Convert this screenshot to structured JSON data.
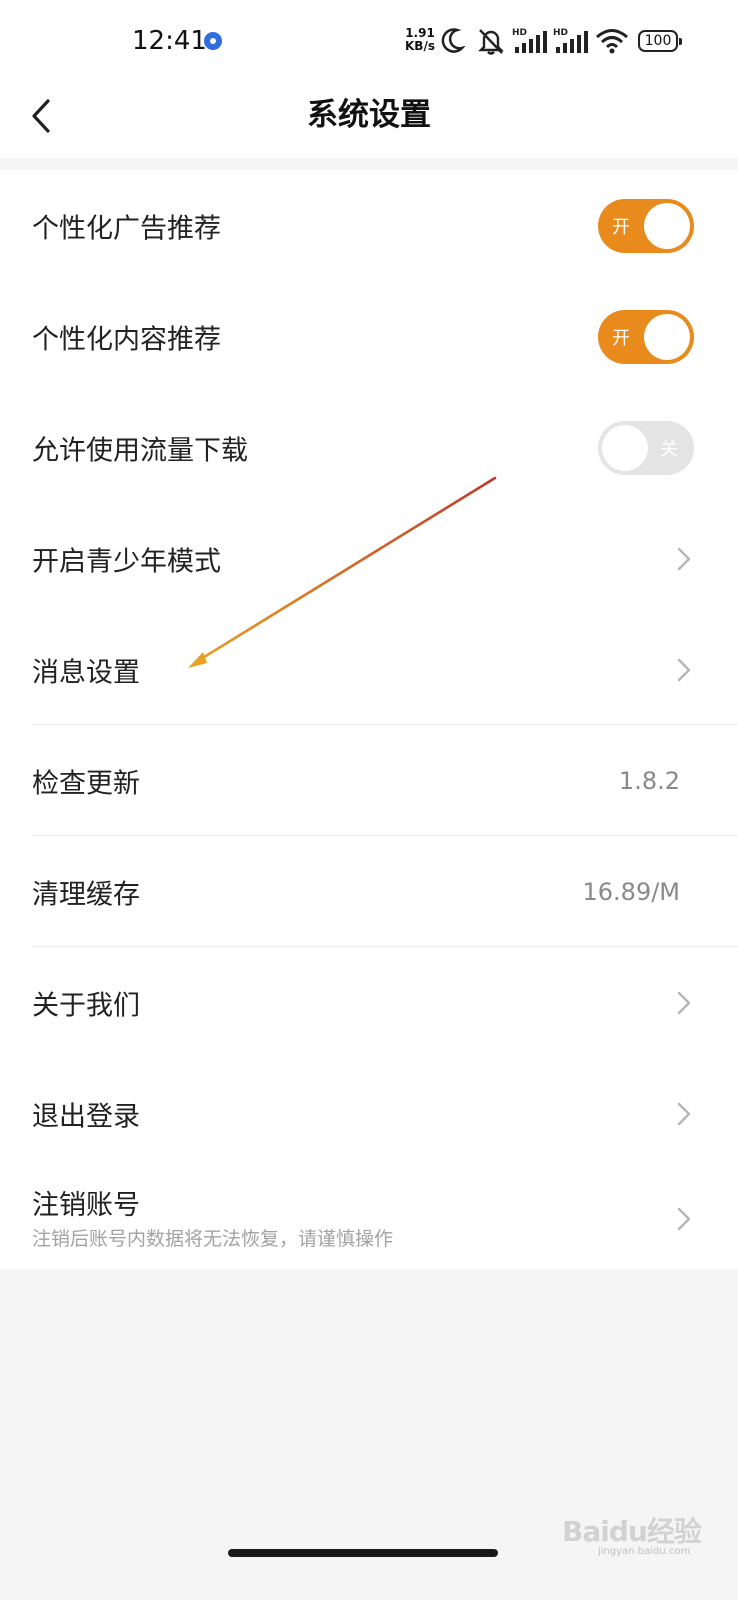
{
  "status_bar": {
    "time": "12:41",
    "net_speed_value": "1.91",
    "net_speed_unit": "KB/s",
    "signal1_label": "HD",
    "signal2_label": "HD",
    "battery": "100"
  },
  "header": {
    "title": "系统设置"
  },
  "settings": {
    "personalized_ads": {
      "label": "个性化广告推荐",
      "toggle_text": "开",
      "state": "on"
    },
    "personalized_content": {
      "label": "个性化内容推荐",
      "toggle_text": "开",
      "state": "on"
    },
    "mobile_data_download": {
      "label": "允许使用流量下载",
      "toggle_text": "关",
      "state": "off"
    },
    "teen_mode": {
      "label": "开启青少年模式"
    },
    "message_settings": {
      "label": "消息设置"
    },
    "check_update": {
      "label": "检查更新",
      "value": "1.8.2"
    },
    "clear_cache": {
      "label": "清理缓存",
      "value": "16.89/M"
    },
    "about_us": {
      "label": "关于我们"
    },
    "logout": {
      "label": "退出登录"
    },
    "delete_account": {
      "label": "注销账号",
      "subtitle": "注销后账号内数据将无法恢复，请谨慎操作"
    }
  },
  "watermark": {
    "main_a": "Bai",
    "main_b": "du",
    "main_c": "经验",
    "sub": "jingyan.baidu.com"
  },
  "colors": {
    "accent": "#e88a1c",
    "toggle_off": "#e4e4e4",
    "background": "#f5f5f5"
  }
}
